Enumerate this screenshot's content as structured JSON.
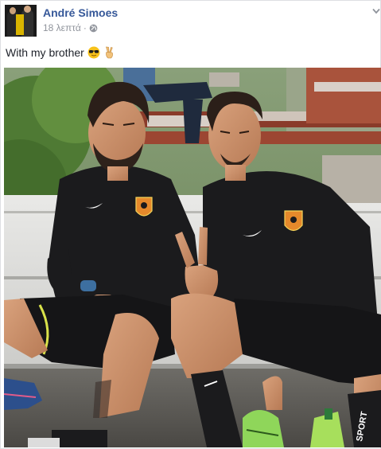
{
  "post": {
    "author_name": "André Simoes",
    "timestamp": "18 λεπτά",
    "separator": "·",
    "privacy_icon": "globe-icon",
    "options_icon": "chevron-down-icon",
    "caption_text": "With my brother",
    "caption_emojis": [
      "sunglasses-emoji",
      "victory-hand-emoji"
    ]
  },
  "photo": {
    "description_icon": "photo",
    "jersey_text": "SPORT"
  },
  "colors": {
    "link_blue": "#365899",
    "meta_grey": "#90949c",
    "text_dark": "#1d2129",
    "jersey_black": "#1b1b1d",
    "crest_orange": "#e5892b"
  }
}
